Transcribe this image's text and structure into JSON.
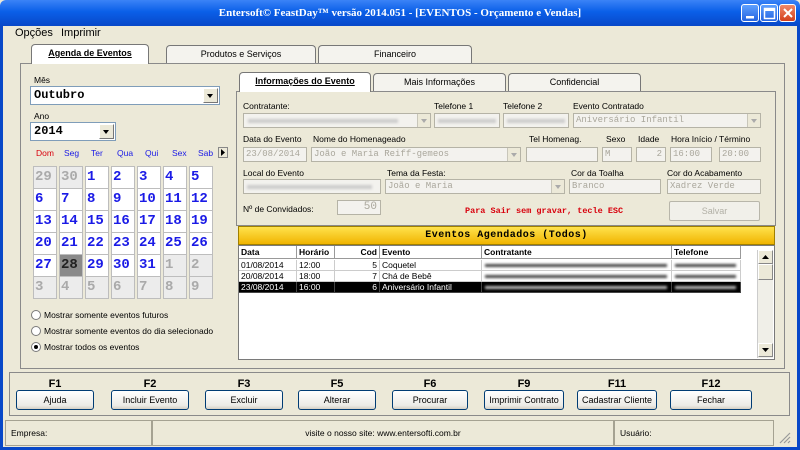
{
  "window": {
    "title": "Entersoft© FeastDay™ versão 2014.051 - [EVENTOS - Orçamento e Vendas]"
  },
  "menu": [
    "Opções",
    "Imprimir"
  ],
  "main_tabs": [
    "Agenda de Eventos",
    "Produtos e Serviços",
    "Financeiro"
  ],
  "calendar": {
    "month_label": "Mês",
    "month_value": "Outubro",
    "year_label": "Ano",
    "year_value": "2014",
    "weekdays": [
      "Dom",
      "Seg",
      "Ter",
      "Qua",
      "Qui",
      "Sex",
      "Sab"
    ],
    "weeks": [
      [
        "29",
        "30",
        "1",
        "2",
        "3",
        "4",
        "5"
      ],
      [
        "6",
        "7",
        "8",
        "9",
        "10",
        "11",
        "12"
      ],
      [
        "13",
        "14",
        "15",
        "16",
        "17",
        "18",
        "19"
      ],
      [
        "20",
        "21",
        "22",
        "23",
        "24",
        "25",
        "26"
      ],
      [
        "27",
        "28",
        "29",
        "30",
        "31",
        "1",
        "2"
      ],
      [
        "3",
        "4",
        "5",
        "6",
        "7",
        "8",
        "9"
      ]
    ],
    "selected_day": "28"
  },
  "filter_options": [
    "Mostrar somente eventos futuros",
    "Mostrar somente eventos do dia selecionado",
    "Mostrar todos os eventos"
  ],
  "filter_selected": 2,
  "sub_tabs": [
    "Informações do Evento",
    "Mais Informações",
    "Confidencial"
  ],
  "form": {
    "contratante_label": "Contratante:",
    "telefone1_label": "Telefone 1",
    "telefone2_label": "Telefone 2",
    "evento_label": "Evento Contratado",
    "evento_value": "Aniversário Infantil",
    "data_label": "Data do Evento",
    "data_value": "23/08/2014",
    "homenageado_label": "Nome do Homenageado",
    "homenageado_value": "João e Maria Reiff-gemeos",
    "tel_homenag_label": "Tel Homenag.",
    "sexo_label": "Sexo",
    "sexo_value": "M",
    "idade_label": "Idade",
    "idade_value": "2",
    "hora_label": "Hora Início / Término",
    "hora_inicio": "16:00",
    "hora_fim": "20:00",
    "local_label": "Local do Evento",
    "tema_label": "Tema da Festa:",
    "tema_value": "João e Maria",
    "toalha_label": "Cor da Toalha",
    "toalha_value": "Branco",
    "acabamento_label": "Cor do Acabamento",
    "acabamento_value": "Xadrez Verde",
    "convidados_label": "Nº de Convidados:",
    "convidados_value": "50",
    "exit_message": "Para Sair sem gravar, tecle ESC",
    "save_label": "Salvar"
  },
  "events": {
    "header": "Eventos Agendados (Todos)",
    "columns": [
      "Data",
      "Horário",
      "Cod",
      "Evento",
      "Contratante",
      "Telefone"
    ],
    "rows": [
      {
        "data": "01/08/2014",
        "horario": "12:00",
        "cod": "5",
        "evento": "Coquetel"
      },
      {
        "data": "20/08/2014",
        "horario": "18:00",
        "cod": "7",
        "evento": "Chá de Bebê"
      },
      {
        "data": "23/08/2014",
        "horario": "16:00",
        "cod": "6",
        "evento": "Aniversário Infantil"
      }
    ],
    "selected_row": 2
  },
  "function_keys": [
    {
      "key": "F1",
      "label": "Ajuda"
    },
    {
      "key": "F2",
      "label": "Incluir Evento"
    },
    {
      "key": "F3",
      "label": "Excluir"
    },
    {
      "key": "F5",
      "label": "Alterar"
    },
    {
      "key": "F6",
      "label": "Procurar"
    },
    {
      "key": "F9",
      "label": "Imprimir Contrato"
    },
    {
      "key": "F11",
      "label": "Cadastrar Cliente"
    },
    {
      "key": "F12",
      "label": "Fechar"
    }
  ],
  "status": {
    "empresa_label": "Empresa:",
    "site_text": "visite o nosso site: www.entersofti.com.br",
    "usuario_label": "Usuário:"
  },
  "colors": {
    "title_bar": "#0a5fe8",
    "events_header": "#f0b400",
    "exit_message": "#d8000c",
    "calendar_day": "#1a1ae6",
    "weekend_label": "#d8000c",
    "weekday_label": "#1a1ae6"
  }
}
